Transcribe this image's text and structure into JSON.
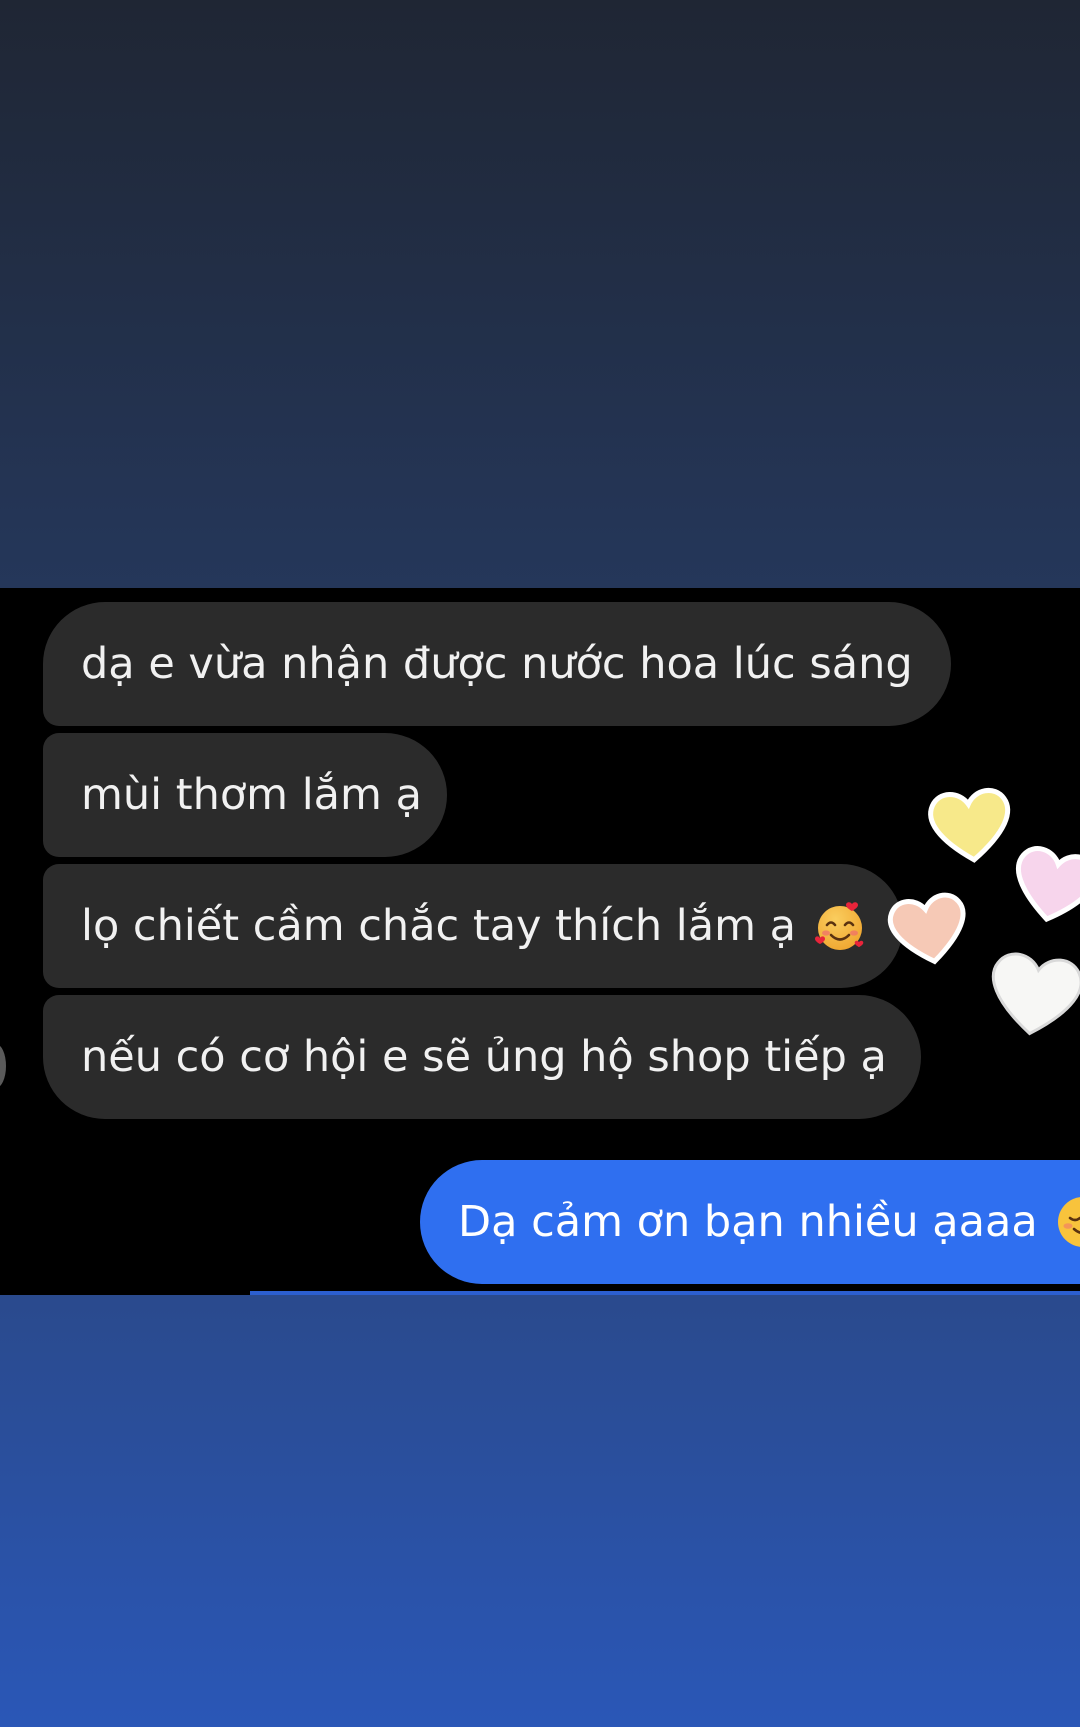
{
  "conversation": {
    "messages": [
      {
        "sender": "customer",
        "text": "dạ e vừa nhận được nước hoa lúc sáng"
      },
      {
        "sender": "customer",
        "text": "mùi thơm lắm ạ"
      },
      {
        "sender": "customer",
        "text": "lọ chiết cầm chắc tay thích lắm ạ",
        "emoji": "smiling-face-with-hearts-icon"
      },
      {
        "sender": "customer",
        "text": "nếu có cơ hội e sẽ ủng hộ shop tiếp ạ"
      },
      {
        "sender": "shop",
        "text": "Dạ cảm ơn bạn nhiều ạaaa",
        "emoji": "smiling-face-icon"
      }
    ]
  },
  "stickers": [
    "yellow-heart-icon",
    "pink-heart-icon",
    "peach-heart-icon",
    "white-heart-icon"
  ],
  "colors": {
    "incoming_bubble": "#2b2b2b",
    "outgoing_bubble": "#2f6ff0",
    "chat_background": "#000000",
    "top_gradient": "#1f2634",
    "bottom_gradient": "#2a57b7"
  }
}
